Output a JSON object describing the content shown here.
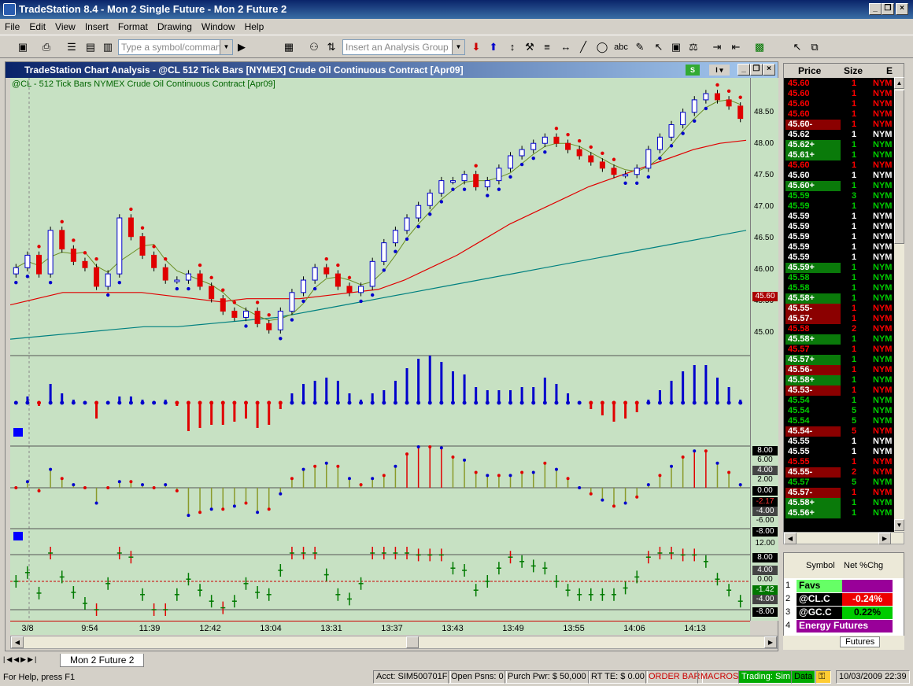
{
  "window": {
    "title": "TradeStation 8.4 - Mon 2 Single Future - Mon 2 Future 2"
  },
  "menu": [
    "File",
    "Edit",
    "View",
    "Insert",
    "Format",
    "Drawing",
    "Window",
    "Help"
  ],
  "toolbar": {
    "symbol_placeholder": "Type a symbol/command",
    "analysis_placeholder": "Insert an Analysis Group"
  },
  "chart": {
    "window_title": "TradeStation Chart Analysis - @CL  512 Tick Bars [NYMEX] Crude Oil Continuous Contract [Apr09]",
    "subtitle": "@CL - 512 Tick Bars  NYMEX  Crude Oil Continuous Contract [Apr09]",
    "price_ticks": [
      "48.50",
      "48.00",
      "47.50",
      "47.00",
      "46.50",
      "46.00",
      "45.50",
      "45.00"
    ],
    "last_price": "45.60",
    "osc1_labels": [
      "8.00",
      "6.00",
      "4.00",
      "2.00",
      "0.00",
      "-2.17",
      "-4.00",
      "-6.00",
      "-8.00"
    ],
    "osc2_labels": [
      "12.00",
      "8.00",
      "4.00",
      "0.00",
      "-1.42",
      "-4.00",
      "-8.00"
    ],
    "time_ticks": [
      "3/8",
      "9:54",
      "11:39",
      "12:42",
      "13:04",
      "13:31",
      "13:37",
      "13:43",
      "13:49",
      "13:55",
      "14:06",
      "14:13"
    ],
    "colors": {
      "bg": "#c7e1c3",
      "up": "#0000cc",
      "down": "#e00000",
      "ma_red": "#e00000",
      "ma_teal": "#008080",
      "ma_olive": "#6b8e23",
      "osc_green": "#007a00",
      "osc_olive": "#8a9a2a"
    }
  },
  "chart_data": {
    "type": "candlestick",
    "title": "@CL - 512 Tick Bars  NYMEX  Crude Oil Continuous Contract [Apr09]",
    "ylim": [
      44.75,
      48.8
    ],
    "close": [
      46.0,
      46.2,
      45.9,
      46.6,
      46.3,
      46.1,
      46.0,
      45.7,
      45.9,
      46.8,
      46.5,
      46.2,
      46.0,
      45.8,
      45.8,
      45.9,
      45.7,
      45.5,
      45.3,
      45.2,
      45.3,
      45.1,
      45.0,
      45.3,
      45.6,
      45.8,
      46.0,
      45.9,
      45.7,
      45.6,
      45.7,
      46.1,
      46.4,
      46.6,
      46.8,
      47.0,
      47.2,
      47.4,
      47.4,
      47.5,
      47.3,
      47.4,
      47.6,
      47.8,
      47.9,
      48.0,
      48.1,
      48.0,
      47.9,
      47.8,
      47.7,
      47.6,
      47.5,
      47.5,
      47.6,
      47.9,
      48.1,
      48.3,
      48.5,
      48.7,
      48.8,
      48.7,
      48.6,
      48.4
    ],
    "ma_red": [
      45.4,
      45.5,
      45.6,
      45.6,
      45.6,
      45.6,
      45.55,
      45.5,
      45.45,
      45.5,
      45.5,
      45.5,
      45.55,
      45.6,
      45.65,
      45.8,
      46.0,
      46.2,
      46.45,
      46.7,
      46.9,
      47.1,
      47.3,
      47.45,
      47.6,
      47.75,
      47.9,
      48.0,
      48.05
    ],
    "ma_teal": [
      44.85,
      44.9,
      44.95,
      45.0,
      45.05,
      45.05,
      45.1,
      45.15,
      45.2,
      45.3,
      45.4,
      45.5,
      45.6,
      45.7,
      45.8,
      45.9,
      46.0,
      46.1,
      46.2,
      46.3,
      46.4,
      46.5,
      46.6
    ]
  },
  "time_sales": {
    "headers": [
      "Price",
      "Size",
      "E"
    ],
    "rows": [
      {
        "price": "45.60",
        "size": "1",
        "ex": "NYM",
        "style": "red"
      },
      {
        "price": "45.60",
        "size": "1",
        "ex": "NYM",
        "style": "red"
      },
      {
        "price": "45.60",
        "size": "1",
        "ex": "NYM",
        "style": "red"
      },
      {
        "price": "45.60",
        "size": "1",
        "ex": "NYM",
        "style": "red"
      },
      {
        "price": "45.60-",
        "size": "1",
        "ex": "NYM",
        "style": "redbg"
      },
      {
        "price": "45.62",
        "size": "1",
        "ex": "NYM",
        "style": "white"
      },
      {
        "price": "45.62+",
        "size": "1",
        "ex": "NYM",
        "style": "greenbg"
      },
      {
        "price": "45.61+",
        "size": "1",
        "ex": "NYM",
        "style": "greenbg"
      },
      {
        "price": "45.60",
        "size": "1",
        "ex": "NYM",
        "style": "red"
      },
      {
        "price": "45.60",
        "size": "1",
        "ex": "NYM",
        "style": "white"
      },
      {
        "price": "45.60+",
        "size": "1",
        "ex": "NYM",
        "style": "greenbg"
      },
      {
        "price": "45.59",
        "size": "3",
        "ex": "NYM",
        "style": "green"
      },
      {
        "price": "45.59",
        "size": "1",
        "ex": "NYM",
        "style": "green"
      },
      {
        "price": "45.59",
        "size": "1",
        "ex": "NYM",
        "style": "white"
      },
      {
        "price": "45.59",
        "size": "1",
        "ex": "NYM",
        "style": "white"
      },
      {
        "price": "45.59",
        "size": "1",
        "ex": "NYM",
        "style": "white"
      },
      {
        "price": "45.59",
        "size": "1",
        "ex": "NYM",
        "style": "white"
      },
      {
        "price": "45.59",
        "size": "1",
        "ex": "NYM",
        "style": "white"
      },
      {
        "price": "45.59+",
        "size": "1",
        "ex": "NYM",
        "style": "greenbg"
      },
      {
        "price": "45.58",
        "size": "1",
        "ex": "NYM",
        "style": "green"
      },
      {
        "price": "45.58",
        "size": "1",
        "ex": "NYM",
        "style": "green"
      },
      {
        "price": "45.58+",
        "size": "1",
        "ex": "NYM",
        "style": "greenbg"
      },
      {
        "price": "45.55-",
        "size": "1",
        "ex": "NYM",
        "style": "redbg"
      },
      {
        "price": "45.57-",
        "size": "1",
        "ex": "NYM",
        "style": "redbg"
      },
      {
        "price": "45.58",
        "size": "2",
        "ex": "NYM",
        "style": "red"
      },
      {
        "price": "45.58+",
        "size": "1",
        "ex": "NYM",
        "style": "greenbg"
      },
      {
        "price": "45.57",
        "size": "1",
        "ex": "NYM",
        "style": "red"
      },
      {
        "price": "45.57+",
        "size": "1",
        "ex": "NYM",
        "style": "greenbg"
      },
      {
        "price": "45.56-",
        "size": "1",
        "ex": "NYM",
        "style": "redbg"
      },
      {
        "price": "45.58+",
        "size": "1",
        "ex": "NYM",
        "style": "greenbg"
      },
      {
        "price": "45.53-",
        "size": "1",
        "ex": "NYM",
        "style": "redbg"
      },
      {
        "price": "45.54",
        "size": "1",
        "ex": "NYM",
        "style": "green"
      },
      {
        "price": "45.54",
        "size": "5",
        "ex": "NYM",
        "style": "green"
      },
      {
        "price": "45.54",
        "size": "5",
        "ex": "NYM",
        "style": "green"
      },
      {
        "price": "45.54-",
        "size": "5",
        "ex": "NYM",
        "style": "redbg"
      },
      {
        "price": "45.55",
        "size": "1",
        "ex": "NYM",
        "style": "white"
      },
      {
        "price": "45.55",
        "size": "1",
        "ex": "NYM",
        "style": "white"
      },
      {
        "price": "45.55",
        "size": "1",
        "ex": "NYM",
        "style": "red"
      },
      {
        "price": "45.55-",
        "size": "2",
        "ex": "NYM",
        "style": "redbg"
      },
      {
        "price": "45.57",
        "size": "5",
        "ex": "NYM",
        "style": "green"
      },
      {
        "price": "45.57-",
        "size": "1",
        "ex": "NYM",
        "style": "redbg"
      },
      {
        "price": "45.58+",
        "size": "1",
        "ex": "NYM",
        "style": "greenbg"
      },
      {
        "price": "45.56+",
        "size": "1",
        "ex": "NYM",
        "style": "greenbg"
      }
    ]
  },
  "quotes": {
    "headers": [
      "Symbol",
      "Net %Chg"
    ],
    "rows": [
      {
        "n": "1",
        "symbol": "Favs",
        "chg": "",
        "style": "group"
      },
      {
        "n": "2",
        "symbol": "@CL.C",
        "chg": "-0.24%",
        "style": "neg"
      },
      {
        "n": "3",
        "symbol": "@GC.C",
        "chg": "0.22%",
        "style": "pos"
      },
      {
        "n": "4",
        "symbol": "Energy Futures",
        "chg": "",
        "style": "purple"
      }
    ],
    "tab": "Futures"
  },
  "tabs": {
    "active": "Mon 2 Future 2"
  },
  "status": {
    "help": "For Help, press F1",
    "acct": "Acct: SIM500701F",
    "open_psns": "Open Psns: 0",
    "purch": "Purch Pwr: $ 50,000",
    "rt": "RT TE: $ 0.00",
    "order_bar": "ORDER BAR",
    "macros": "MACROS",
    "trading": "Trading: Sim",
    "data": "Data",
    "datetime": "10/03/2009 22:39"
  }
}
